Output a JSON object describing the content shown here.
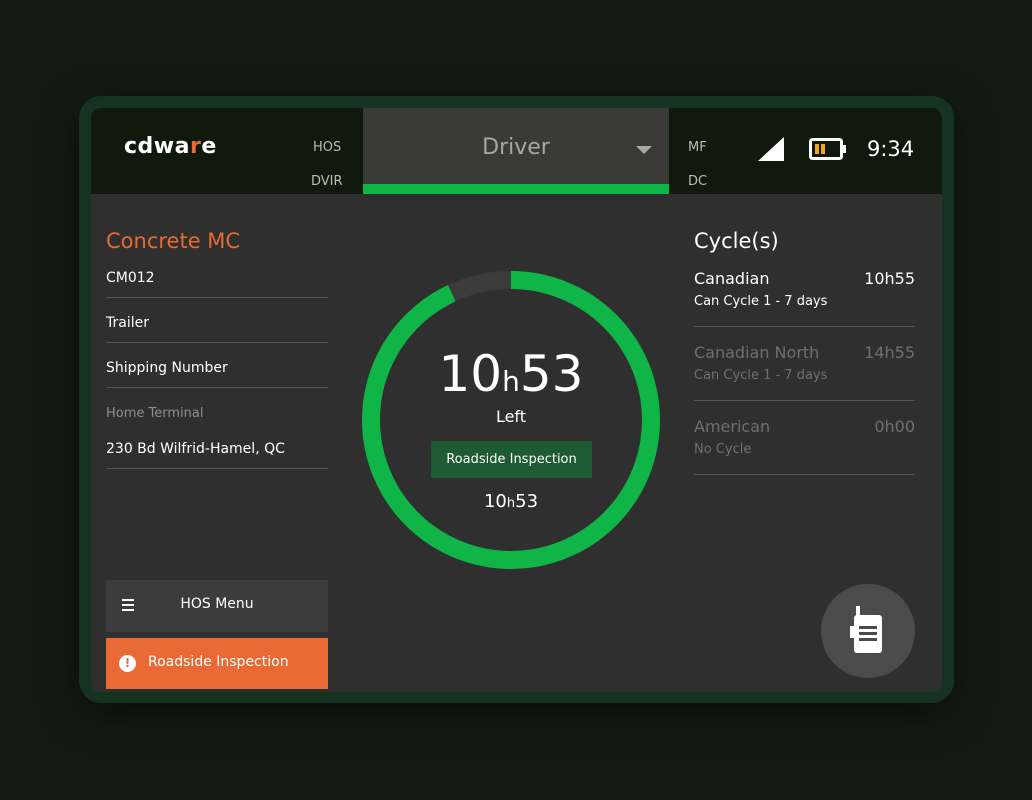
{
  "header": {
    "logo_pre": "cdwa",
    "logo_accent": "r",
    "logo_post": "e",
    "nav_left": [
      "HOS",
      "DVIR"
    ],
    "active_tab": "Driver",
    "nav_right": [
      "MF",
      "DC"
    ],
    "clock": "9:34"
  },
  "left_panel": {
    "company": "Concrete MC",
    "unit": "CM012",
    "trailer": "Trailer",
    "shipping": "Shipping Number",
    "home_terminal_label": "Home Terminal",
    "home_terminal_value": "230 Bd Wilfrid-Hamel, QC",
    "hos_menu": "HOS Menu",
    "roadside_button": "Roadside Inspection"
  },
  "center": {
    "time_hours": "10",
    "time_h": "h",
    "time_minutes": "53",
    "left_label": "Left",
    "status": "Roadside Inspection",
    "small_hours": "10",
    "small_h": "h",
    "small_minutes": "53",
    "ring_progress": 0.93
  },
  "right_panel": {
    "title": "Cycle(s)",
    "cycles": [
      {
        "name": "Canadian",
        "time": "10h55",
        "sub": "Can Cycle 1 - 7 days",
        "active": true
      },
      {
        "name": "Canadian North",
        "time": "14h55",
        "sub": "Can Cycle 1 - 7 days",
        "active": false
      },
      {
        "name": "American",
        "time": "0h00",
        "sub": "No Cycle",
        "active": false
      }
    ]
  },
  "colors": {
    "accent_orange": "#ea6a35",
    "accent_green": "#10b547",
    "battery": "#f2a81d"
  },
  "icons": [
    "signal-icon",
    "battery-icon",
    "menu-icon",
    "warning-icon",
    "walkie-talkie-icon",
    "chevron-down-icon"
  ]
}
